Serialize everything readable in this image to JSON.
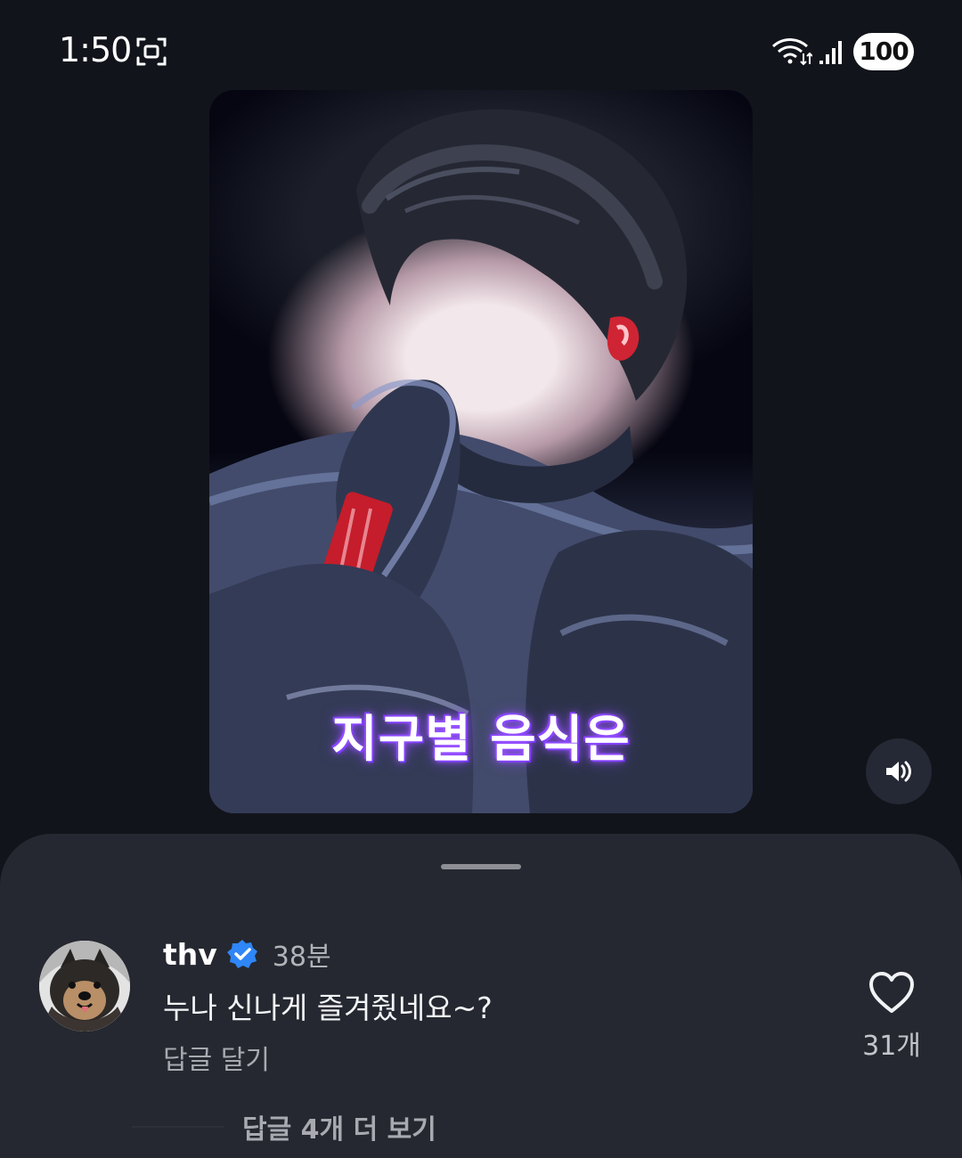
{
  "status_bar": {
    "time": "1:50",
    "battery": "100",
    "icons": [
      "screen-record-icon",
      "wifi-icon",
      "signal-icon",
      "battery-icon"
    ]
  },
  "media": {
    "caption": "지구별 음식은",
    "volume_icon": "volume-icon"
  },
  "comments": {
    "items": [
      {
        "username": "thv",
        "verified_icon": "verified-icon",
        "time_ago": "38분",
        "text": "누나 신나게 즐겨줬네요~?",
        "reply_label": "답글 달기",
        "like_icon": "heart-icon",
        "like_count": "31개"
      }
    ],
    "more_replies_label": "답글 4개 더 보기"
  },
  "colors": {
    "background": "#12141b",
    "sheet": "#252830",
    "text_primary": "#f3f4f7",
    "text_secondary": "#a8aab0",
    "verified": "#2f86f6",
    "caption_glow": "#8b45ff"
  }
}
